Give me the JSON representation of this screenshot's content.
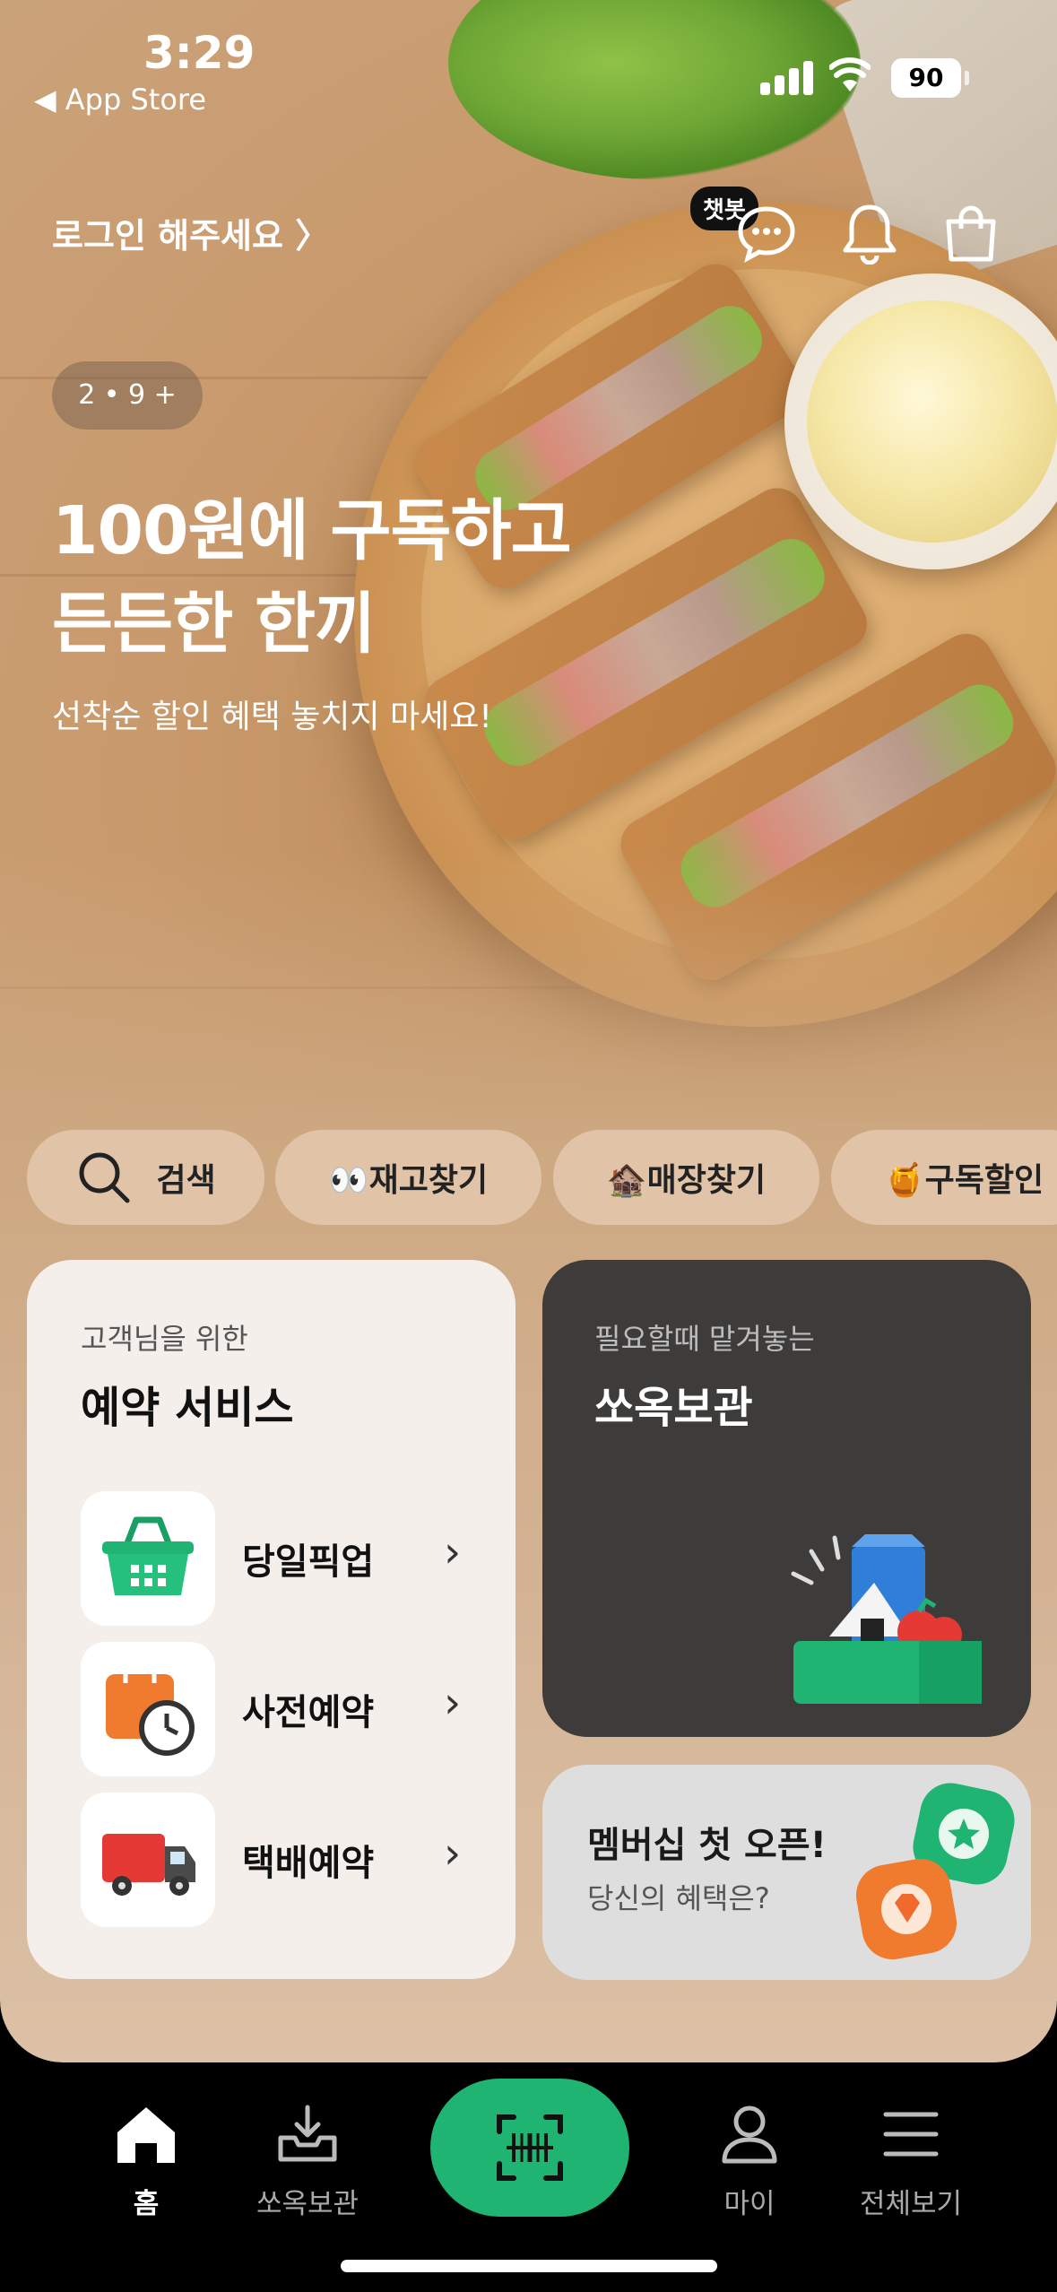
{
  "status_bar": {
    "time": "3:29",
    "back_label": "◀ App Store",
    "battery": "90"
  },
  "header": {
    "login_label": "로그인 해주세요 ",
    "chatbot_badge": "챗봇"
  },
  "hero": {
    "pager": "2 • 9 +",
    "title_line1": "100원에 구독하고",
    "title_line2": "든든한 한끼",
    "subtitle": "선착순 할인 혜택 놓치지 마세요!"
  },
  "chips": [
    {
      "label": "검색"
    },
    {
      "label": "👀재고찾기"
    },
    {
      "label": "🏚️매장찾기"
    },
    {
      "label": "🍯구독할인"
    }
  ],
  "reservation_card": {
    "eyebrow": "고객님을 위한",
    "title": "예약 서비스",
    "items": [
      {
        "label": "당일픽업"
      },
      {
        "label": "사전예약"
      },
      {
        "label": "택배예약"
      }
    ]
  },
  "storage_card": {
    "eyebrow": "필요할때 맡겨놓는",
    "title": "쏘옥보관"
  },
  "membership_card": {
    "title": "멤버십 첫 오픈!",
    "subtitle": "당신의 혜택은?"
  },
  "bottom_nav": {
    "items": [
      {
        "label": "홈"
      },
      {
        "label": "쏘옥보관"
      },
      {
        "label": "마이"
      },
      {
        "label": "전체보기"
      }
    ]
  },
  "colors": {
    "accent_green": "#1fb472",
    "dark_card": "#3e3c3b"
  }
}
